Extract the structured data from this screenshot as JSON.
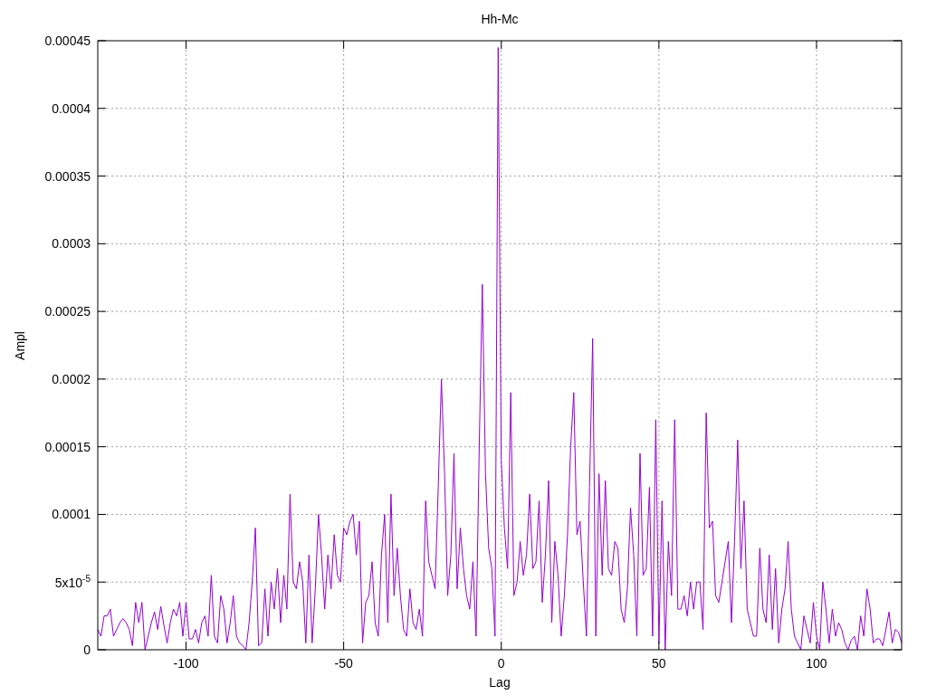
{
  "chart_data": {
    "type": "line",
    "title": "Hh-Mc",
    "xlabel": "Lag",
    "ylabel": "Ampl",
    "xlim": [
      -128,
      127
    ],
    "ylim": [
      0,
      0.00045
    ],
    "xticks": [
      -100,
      -50,
      0,
      50,
      100
    ],
    "yticks": [
      0,
      {
        "value": 5e-05,
        "label": "5x10$^{-5}$"
      },
      0.0001,
      0.00015,
      0.0002,
      0.00025,
      0.0003,
      0.00035,
      0.0004,
      0.00045
    ],
    "x": [
      -128,
      -127,
      -126,
      -125,
      -124,
      -123,
      -122,
      -121,
      -120,
      -119,
      -118,
      -117,
      -116,
      -115,
      -114,
      -113,
      -112,
      -111,
      -110,
      -109,
      -108,
      -107,
      -106,
      -105,
      -104,
      -103,
      -102,
      -101,
      -100,
      -99,
      -98,
      -97,
      -96,
      -95,
      -94,
      -93,
      -92,
      -91,
      -90,
      -89,
      -88,
      -87,
      -86,
      -85,
      -84,
      -83,
      -82,
      -81,
      -80,
      -79,
      -78,
      -77,
      -76,
      -75,
      -74,
      -73,
      -72,
      -71,
      -70,
      -69,
      -68,
      -67,
      -66,
      -65,
      -64,
      -63,
      -62,
      -61,
      -60,
      -59,
      -58,
      -57,
      -56,
      -55,
      -54,
      -53,
      -52,
      -51,
      -50,
      -49,
      -48,
      -47,
      -46,
      -45,
      -44,
      -43,
      -42,
      -41,
      -40,
      -39,
      -38,
      -37,
      -36,
      -35,
      -34,
      -33,
      -32,
      -31,
      -30,
      -29,
      -28,
      -27,
      -26,
      -25,
      -24,
      -23,
      -22,
      -21,
      -20,
      -19,
      -18,
      -17,
      -16,
      -15,
      -14,
      -13,
      -12,
      -11,
      -10,
      -9,
      -8,
      -7,
      -6,
      -5,
      -4,
      -3,
      -2,
      -1,
      0,
      1,
      2,
      3,
      4,
      5,
      6,
      7,
      8,
      9,
      10,
      11,
      12,
      13,
      14,
      15,
      16,
      17,
      18,
      19,
      20,
      21,
      22,
      23,
      24,
      25,
      26,
      27,
      28,
      29,
      30,
      31,
      32,
      33,
      34,
      35,
      36,
      37,
      38,
      39,
      40,
      41,
      42,
      43,
      44,
      45,
      46,
      47,
      48,
      49,
      50,
      51,
      52,
      53,
      54,
      55,
      56,
      57,
      58,
      59,
      60,
      61,
      62,
      63,
      64,
      65,
      66,
      67,
      68,
      69,
      70,
      71,
      72,
      73,
      74,
      75,
      76,
      77,
      78,
      79,
      80,
      81,
      82,
      83,
      84,
      85,
      86,
      87,
      88,
      89,
      90,
      91,
      92,
      93,
      94,
      95,
      96,
      97,
      98,
      99,
      100,
      101,
      102,
      103,
      104,
      105,
      106,
      107,
      108,
      109,
      110,
      111,
      112,
      113,
      114,
      115,
      116,
      117,
      118,
      119,
      120,
      121,
      122,
      123,
      124,
      125,
      126,
      127
    ],
    "grid": true,
    "series": [
      {
        "color": "#9400d3",
        "values": [
          1.5e-05,
          1e-05,
          2.5e-05,
          2.5e-05,
          3e-05,
          1e-05,
          1.5e-05,
          2e-05,
          2.3e-05,
          2e-05,
          1.5e-05,
          3e-06,
          3.5e-05,
          2e-05,
          3.5e-05,
          0,
          1e-05,
          2e-05,
          2.8e-05,
          1.5e-05,
          3.2e-05,
          1.8e-05,
          5e-06,
          2e-05,
          3e-05,
          2.5e-05,
          3.5e-05,
          1e-05,
          3.5e-05,
          8e-06,
          8e-06,
          1.5e-05,
          5e-06,
          2e-05,
          2.5e-05,
          1e-05,
          5.5e-05,
          1e-05,
          5e-06,
          4e-05,
          3e-05,
          5e-06,
          2e-05,
          4e-05,
          1e-05,
          5e-06,
          3e-06,
          0,
          2e-05,
          5e-05,
          9e-05,
          3e-06,
          5e-06,
          4.5e-05,
          1e-05,
          5e-05,
          3e-05,
          6e-05,
          2e-05,
          5.5e-05,
          3e-05,
          0.000115,
          5e-05,
          4.5e-05,
          6.5e-05,
          5e-05,
          5e-06,
          7e-05,
          5e-06,
          4.5e-05,
          0.0001,
          7e-05,
          3e-05,
          7e-05,
          4.5e-05,
          8.5e-05,
          5.5e-05,
          5e-05,
          9e-05,
          8.5e-05,
          9.5e-05,
          0.0001,
          7e-05,
          9.5e-05,
          5e-06,
          3.5e-05,
          4e-05,
          6.5e-05,
          2e-05,
          1e-05,
          7e-05,
          0.0001,
          2e-05,
          0.000115,
          4e-05,
          7.5e-05,
          4e-05,
          1.5e-05,
          1e-05,
          4.5e-05,
          2e-05,
          1.5e-05,
          3e-05,
          1e-05,
          0.00011,
          6.5e-05,
          5.5e-05,
          4.5e-05,
          0.00012,
          0.0002,
          0.00013,
          4e-05,
          7e-05,
          0.000145,
          4.5e-05,
          9e-05,
          6e-05,
          4e-05,
          3e-05,
          6.5e-05,
          1e-05,
          0.00015,
          0.00027,
          0.00013,
          7.5e-05,
          6e-05,
          1e-05,
          0.000445,
          0.00014,
          9e-05,
          6e-05,
          0.00019,
          4e-05,
          5e-05,
          8e-05,
          5.5e-05,
          7e-05,
          0.000115,
          6e-05,
          6.5e-05,
          0.00011,
          3.5e-05,
          7e-05,
          0.000125,
          2e-05,
          8e-05,
          5.5e-05,
          1e-05,
          4e-05,
          8.5e-05,
          0.00015,
          0.00019,
          8.5e-05,
          9.5e-05,
          5e-05,
          1e-05,
          0.00012,
          0.00023,
          1e-05,
          0.00013,
          5.5e-05,
          0.000125,
          6e-05,
          5.5e-05,
          8e-05,
          7.5e-05,
          3e-05,
          2e-05,
          4.5e-05,
          0.000105,
          7e-05,
          1e-05,
          0.000145,
          5.5e-05,
          6e-05,
          0.00012,
          1e-05,
          0.00017,
          5e-06,
          0.00011,
          0,
          8e-05,
          4e-05,
          0.00017,
          3e-05,
          3e-05,
          4e-05,
          2.5e-05,
          5e-05,
          3e-05,
          5e-05,
          5e-05,
          1.5e-05,
          0.000175,
          9e-05,
          9.5e-05,
          4e-05,
          3.5e-05,
          5e-05,
          6.5e-05,
          8e-05,
          2e-05,
          8e-05,
          0.000155,
          6e-05,
          0.00011,
          3e-05,
          2e-05,
          1e-05,
          1e-05,
          7.5e-05,
          3e-05,
          2e-05,
          7e-05,
          1.5e-05,
          6e-05,
          5e-06,
          3e-05,
          4.5e-05,
          8e-05,
          3e-05,
          1e-05,
          5e-06,
          0,
          2.5e-05,
          1.5e-05,
          5e-06,
          3.5e-05,
          1e-05,
          0,
          5e-05,
          3e-05,
          5e-06,
          3e-05,
          1e-05,
          2e-05,
          1.5e-05,
          5e-06,
          0,
          7e-06,
          1e-05,
          0,
          2.5e-05,
          1e-05,
          4.5e-05,
          3e-05,
          5e-06,
          8e-06,
          8e-06,
          3e-06,
          1.5e-05,
          2.8e-05,
          5e-06,
          1.5e-05,
          1.3e-05,
          5e-06
        ]
      }
    ]
  }
}
